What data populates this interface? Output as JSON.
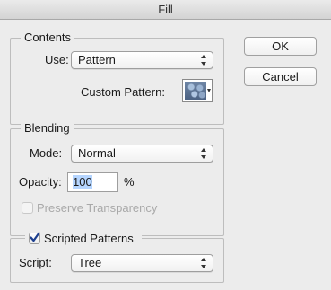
{
  "window": {
    "title": "Fill"
  },
  "contents": {
    "legend": "Contents",
    "use_label": "Use:",
    "use_value": "Pattern",
    "custom_pattern_label": "Custom Pattern:"
  },
  "blending": {
    "legend": "Blending",
    "mode_label": "Mode:",
    "mode_value": "Normal",
    "opacity_label": "Opacity:",
    "opacity_value": "100",
    "opacity_unit": "%",
    "preserve_label": "Preserve Transparency",
    "preserve_checked": false,
    "preserve_enabled": false
  },
  "scripted": {
    "checkbox_label": "Scripted Patterns",
    "checked": true,
    "script_label": "Script:",
    "script_value": "Tree"
  },
  "buttons": {
    "ok": "OK",
    "cancel": "Cancel"
  }
}
